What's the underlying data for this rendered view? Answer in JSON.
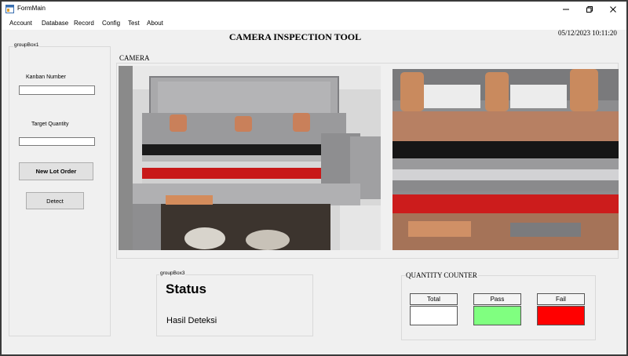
{
  "window": {
    "title": "FormMain",
    "icon": "form-app-icon",
    "controls": [
      "minimize-icon",
      "maximize-icon",
      "close-icon"
    ]
  },
  "menu": {
    "items": [
      "Account",
      "Database",
      "Record",
      "Config",
      "Test",
      "About"
    ]
  },
  "header": {
    "title": "CAMERA INSPECTION TOOL",
    "datetime": "05/12/2023 10:11:20"
  },
  "left_panel": {
    "group_title": "groupBox1",
    "kanban_label": "Kanban Number",
    "kanban_value": "",
    "target_label": "Target Quantity",
    "target_value": "",
    "new_lot_button": "New Lot Order",
    "detect_button": "Detect"
  },
  "camera": {
    "label": "CAMERA",
    "views": [
      "camera-view-1",
      "camera-view-2"
    ]
  },
  "status_panel": {
    "group_title": "groupBox3",
    "title": "Status",
    "result": "Hasil Deteksi"
  },
  "quantity_counter": {
    "title": "QUANTITY COUNTER",
    "total_label": "Total",
    "pass_label": "Pass",
    "fail_label": "Fail",
    "colors": {
      "total": "#ffffff",
      "pass": "#80ff80",
      "fail": "#ff0000"
    }
  }
}
